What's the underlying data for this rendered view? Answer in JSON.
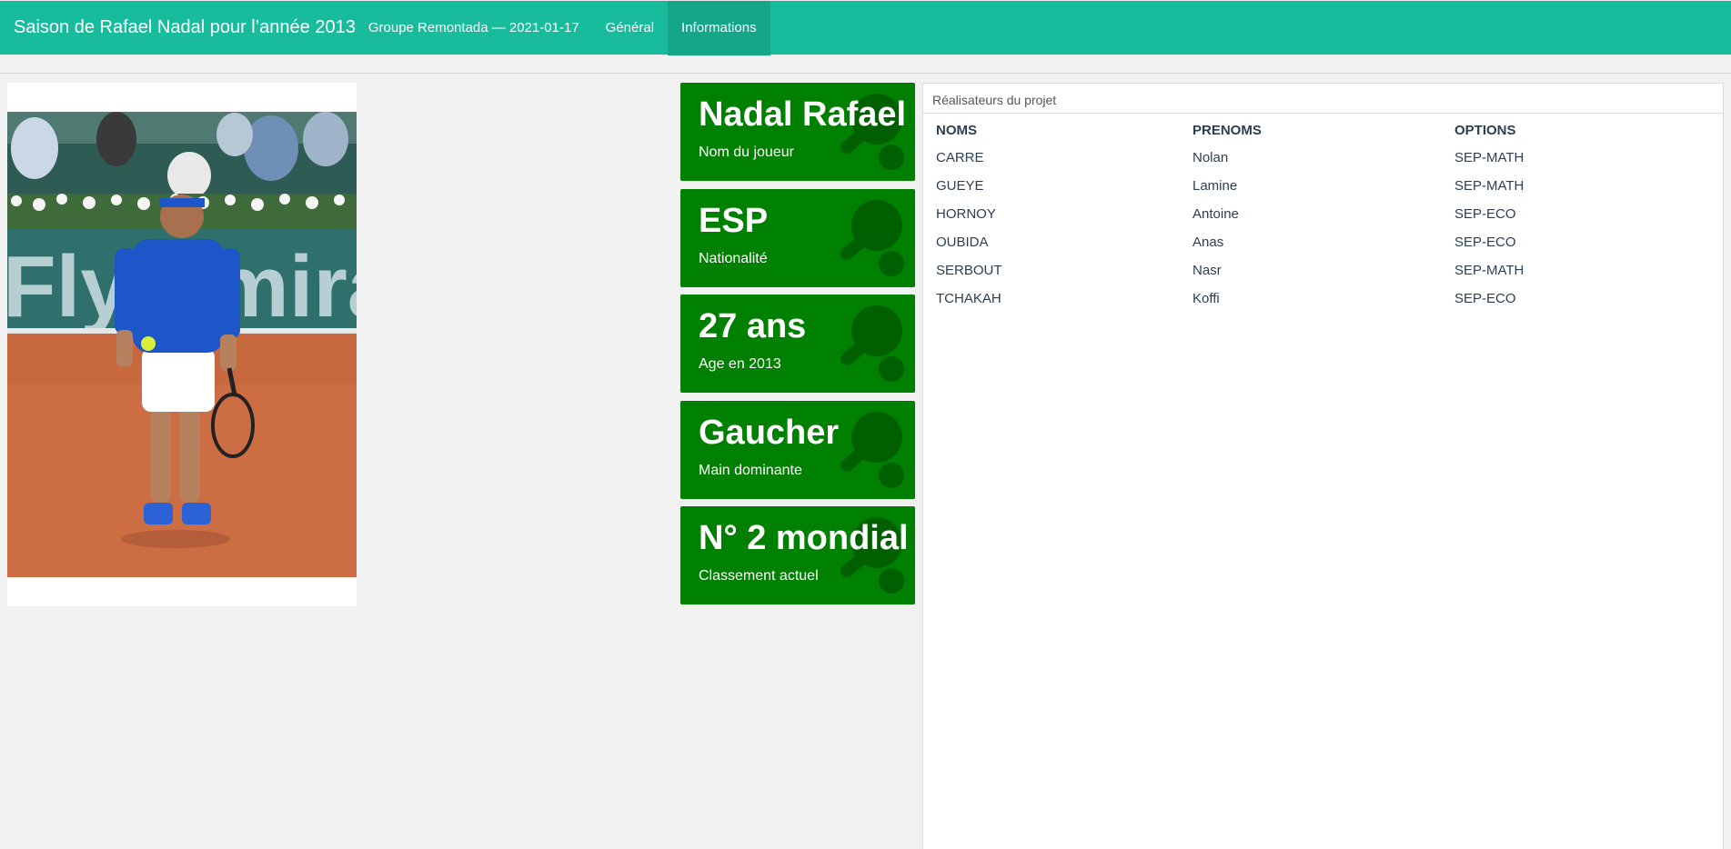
{
  "header": {
    "title": "Saison de Rafael Nadal pour l’année 2013",
    "subtitle": "Groupe Remontada — 2021-01-17",
    "tabs": [
      {
        "label": "Général",
        "active": false
      },
      {
        "label": "Informations",
        "active": true
      }
    ]
  },
  "colors": {
    "navbar": "#18bc9c",
    "active_tab": "#15a589",
    "value_box": "#008000"
  },
  "valueboxes": [
    {
      "value": "Nadal Rafael",
      "label": "Nom du joueur",
      "icon": "table-tennis-icon"
    },
    {
      "value": "ESP",
      "label": "Nationalité",
      "icon": "table-tennis-icon"
    },
    {
      "value": "27 ans",
      "label": "Age en 2013",
      "icon": "table-tennis-icon"
    },
    {
      "value": "Gaucher",
      "label": "Main dominante",
      "icon": "table-tennis-icon"
    },
    {
      "value": "N° 2 mondial",
      "label": "Classement actuel",
      "icon": "table-tennis-icon"
    }
  ],
  "team": {
    "heading": "Réalisateurs du projet",
    "columns": [
      "NOMS",
      "PRENOMS",
      "OPTIONS"
    ],
    "rows": [
      [
        "CARRE",
        "Nolan",
        "SEP-MATH"
      ],
      [
        "GUEYE",
        "Lamine",
        "SEP-MATH"
      ],
      [
        "HORNOY",
        "Antoine",
        "SEP-ECO"
      ],
      [
        "OUBIDA",
        "Anas",
        "SEP-ECO"
      ],
      [
        "SERBOUT",
        "Nasr",
        "SEP-MATH"
      ],
      [
        "TCHAKAH",
        "Koffi",
        "SEP-ECO"
      ]
    ]
  }
}
